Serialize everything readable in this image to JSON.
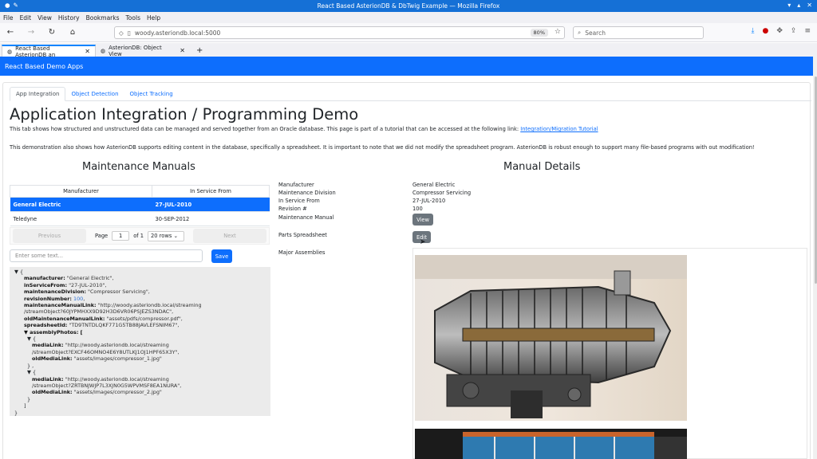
{
  "window": {
    "title": "React Based AsterionDB & DbTwig Example — Mozilla Firefox"
  },
  "menu": [
    "File",
    "Edit",
    "View",
    "History",
    "Bookmarks",
    "Tools",
    "Help"
  ],
  "browser": {
    "url": "woody.asteriondb.local:5000",
    "zoom": "80%",
    "search_placeholder": "Search",
    "tabs": [
      {
        "label": "React Based AsterionDB an",
        "active": true
      },
      {
        "label": "AsterionDB: Object View",
        "active": false
      }
    ]
  },
  "app": {
    "brand": "React Based Demo Apps",
    "tabs": [
      "App Integration",
      "Object Detection",
      "Object Tracking"
    ],
    "title": "Application Integration / Programming Demo",
    "intro1": "This tab shows how structured and unstructured data can be managed and served together from an Oracle database. This page is part of a tutorial that can be accessed at the following link: ",
    "intro1_link": "Integration/Migration Tutorial",
    "intro2": "This demonstration also shows how AsterionDB supports editing content in the database, specifically a spreadsheet. It is important to note that we did not modify the spreadsheet program. AsterionDB is robust enough to support many file-based programs with out modification!"
  },
  "manuals": {
    "heading": "Maintenance Manuals",
    "columns": [
      "Manufacturer",
      "In Service From"
    ],
    "rows": [
      {
        "manufacturer": "General Electric",
        "in_service": "27-JUL-2010",
        "selected": true
      },
      {
        "manufacturer": "Teledyne",
        "in_service": "30-SEP-2012",
        "selected": false
      }
    ],
    "pager": {
      "previous": "Previous",
      "page_label": "Page",
      "page": "1",
      "of": "of 1",
      "rows": "20 rows",
      "next": "Next"
    },
    "text_placeholder": "Enter some text...",
    "save": "Save"
  },
  "json_view": {
    "open": "▼ {",
    "fields": [
      {
        "k": "manufacturer:",
        "v": "\"General Electric\","
      },
      {
        "k": "inServiceFrom:",
        "v": "\"27-JUL-2010\","
      },
      {
        "k": "maintenanceDivision:",
        "v": "\"Compressor Servicing\","
      },
      {
        "k": "revisionNumber:",
        "v": "100",
        "num": true,
        "tail": ","
      },
      {
        "k": "maintenanceManualLink:",
        "v": "\"http://woody.asteriondb.local/streaming"
      },
      {
        "k": "",
        "v": "/streamObject?60JYPMHXX9D92H3D6VR06PSJEZS3NDAC\","
      },
      {
        "k": "oldMaintenanceManualLink:",
        "v": "\"assets/pdfs/compressor.pdf\","
      },
      {
        "k": "spreadsheetId:",
        "v": "\"TD9TNTDLQKF771G5TB88JAVLEFSNIM67\","
      }
    ],
    "photos_key": "▼ assemblyPhotos: [",
    "photo_open": "▼ {",
    "photo_close": "} ,",
    "photo_end": "}",
    "media_key": "mediaLink:",
    "old_key": "oldMediaLink:",
    "photo1_link": "\"http://woody.asteriondb.local/streaming",
    "photo1_link2": "/streamObject?EXCF46OMNO4E6Y8UTLKJ1OJ1HPF65X3Y\",",
    "photo1_old": "\"assets/images/compressor_1.jpg\"",
    "photo2_link": "\"http://woody.asteriondb.local/streaming",
    "photo2_link2": "/streamObject?ZRTBNJWJP7L3XJN0G5WPVMSF8EA1NURA\",",
    "photo2_old": "\"assets/images/compressor_2.jpg\"",
    "array_close": "]",
    "obj_close": "}"
  },
  "details": {
    "heading": "Manual Details",
    "labels": [
      "Manufacturer",
      "Maintenance Division",
      "In Service From",
      "Revision #",
      "Maintenance Manual",
      "Parts Spreadsheet",
      "Major Assemblies"
    ],
    "values": [
      "General Electric",
      "Compressor Servicing",
      "27-JUL-2010",
      "100"
    ],
    "view": "View",
    "edit": "Edit"
  },
  "colors": {
    "primary": "#0d6efd",
    "firefox_title": "#1570d6"
  }
}
